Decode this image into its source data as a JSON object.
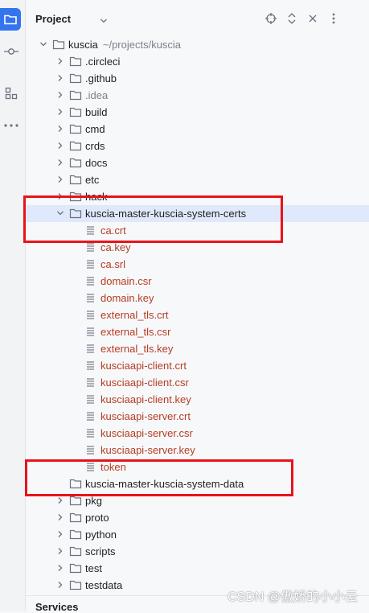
{
  "header": {
    "title": "Project",
    "icons": [
      "target-icon",
      "expand-collapse-icon",
      "close-icon",
      "more-vertical-icon"
    ]
  },
  "strip": {
    "icons": [
      "project-folder-icon",
      "commit-icon",
      "structure-icon",
      "more-icon"
    ]
  },
  "tree": {
    "root": {
      "name": "kuscia",
      "path": "~/projects/kuscia"
    },
    "folders_top": [
      ".circleci",
      ".github",
      ".idea",
      "build",
      "cmd",
      "crds",
      "docs",
      "etc",
      "hack"
    ],
    "certs_folder": "kuscia-master-kuscia-system-certs",
    "cert_files": [
      "ca.crt",
      "ca.key",
      "ca.srl",
      "domain.csr",
      "domain.key",
      "external_tls.crt",
      "external_tls.csr",
      "external_tls.key",
      "kusciaapi-client.crt",
      "kusciaapi-client.csr",
      "kusciaapi-client.key",
      "kusciaapi-server.crt",
      "kusciaapi-server.csr",
      "kusciaapi-server.key",
      "token"
    ],
    "data_folder": "kuscia-master-kuscia-system-data",
    "folders_bottom": [
      "pkg",
      "proto",
      "python",
      "scripts",
      "test",
      "testdata"
    ]
  },
  "services": {
    "label": "Services"
  },
  "watermark": "CSDN @傲娇的小小云",
  "colors": {
    "accent": "#3574f0",
    "selection": "#dfe9fb",
    "file_text": "#b53d23",
    "annotation": "#e8131a"
  }
}
